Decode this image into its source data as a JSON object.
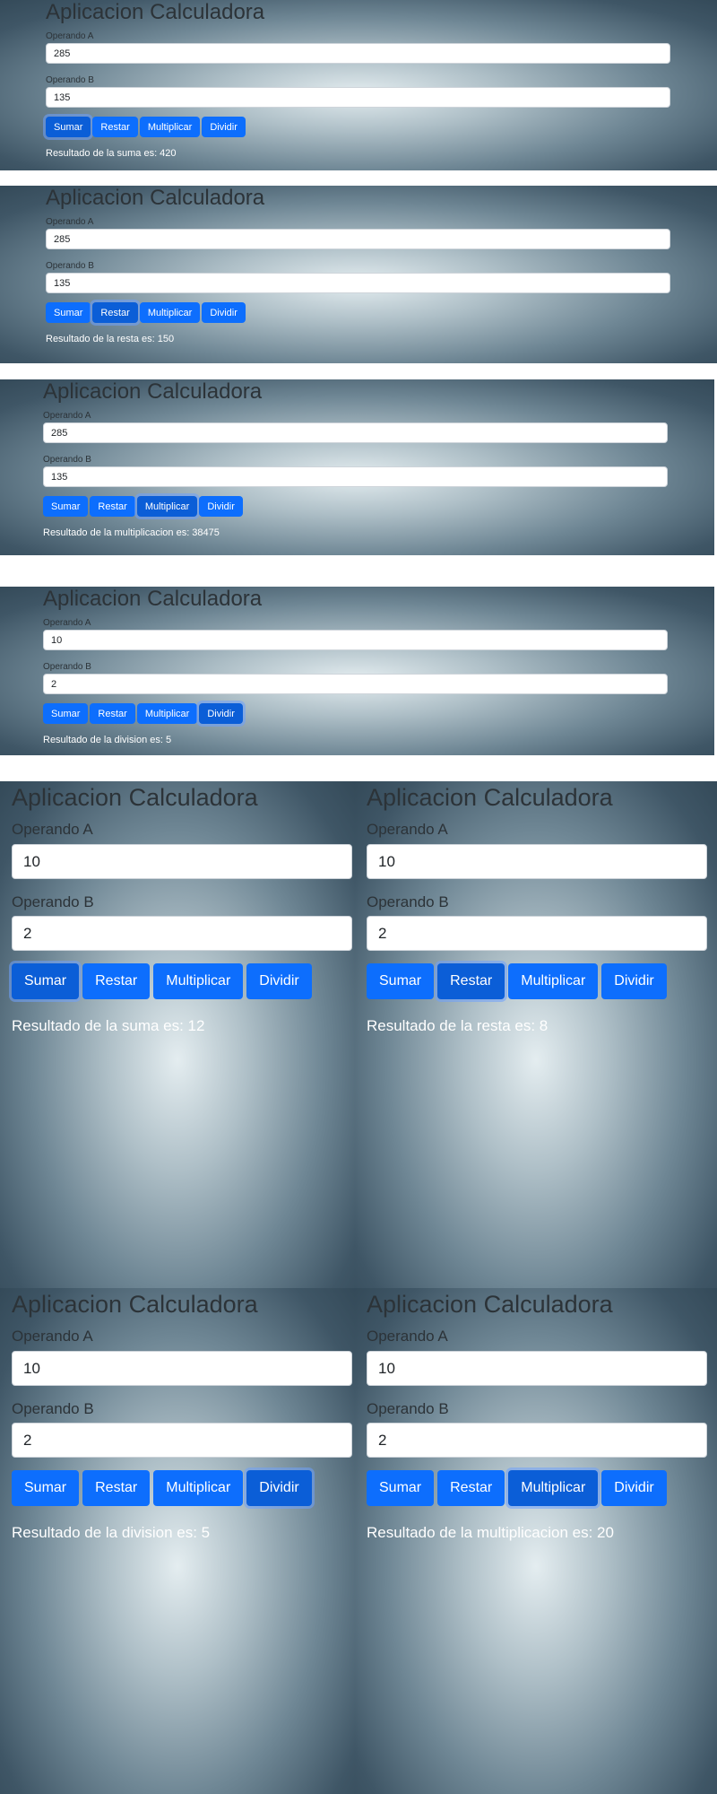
{
  "app": {
    "title": "Aplicacion Calculadora",
    "label_a": "Operando A",
    "label_b": "Operando B",
    "buttons": [
      "Sumar",
      "Restar",
      "Multiplicar",
      "Dividir"
    ]
  },
  "colors": {
    "button_primary": "#0d6efd",
    "button_active": "#0b5ed7",
    "result_text": "#ffffff"
  },
  "screens": [
    {
      "operand_a": "285",
      "operand_b": "135",
      "active_button": "Sumar",
      "result": "Resultado de la suma es: 420"
    },
    {
      "operand_a": "285",
      "operand_b": "135",
      "active_button": "Restar",
      "result": "Resultado de la resta es: 150"
    },
    {
      "operand_a": "285",
      "operand_b": "135",
      "active_button": "Multiplicar",
      "result": "Resultado de la multiplicacion es: 38475"
    },
    {
      "operand_a": "10",
      "operand_b": "2",
      "active_button": "Dividir",
      "result": "Resultado de la division es: 5"
    },
    {
      "operand_a": "10",
      "operand_b": "2",
      "active_button": "Sumar",
      "result": "Resultado de la suma es: 12"
    },
    {
      "operand_a": "10",
      "operand_b": "2",
      "active_button": "Restar",
      "result": "Resultado de la resta es: 8"
    },
    {
      "operand_a": "10",
      "operand_b": "2",
      "active_button": "Dividir",
      "result": "Resultado de la division es: 5"
    },
    {
      "operand_a": "10",
      "operand_b": "2",
      "active_button": "Multiplicar",
      "result": "Resultado de la multiplicacion es: 20"
    }
  ]
}
